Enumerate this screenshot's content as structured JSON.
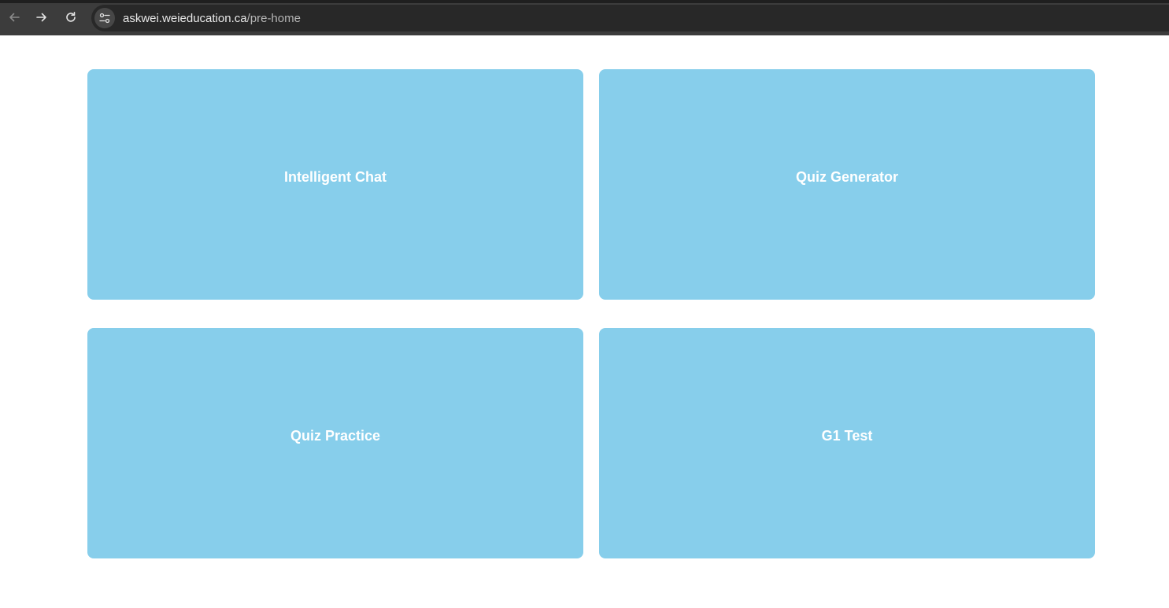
{
  "browser": {
    "url_host": "askwei.weieducation.ca",
    "url_path": "/pre-home",
    "icons": {
      "back": "arrow-left-icon",
      "forward": "arrow-right-icon",
      "reload": "reload-icon",
      "site_info": "tune-icon"
    }
  },
  "cards": [
    {
      "label": "Intelligent Chat"
    },
    {
      "label": "Quiz Generator"
    },
    {
      "label": "Quiz Practice"
    },
    {
      "label": "G1 Test"
    }
  ],
  "colors": {
    "card_background": "#87ceeb",
    "card_text": "#ffffff",
    "page_background": "#ffffff",
    "toolbar_background": "#3c3c3c"
  }
}
